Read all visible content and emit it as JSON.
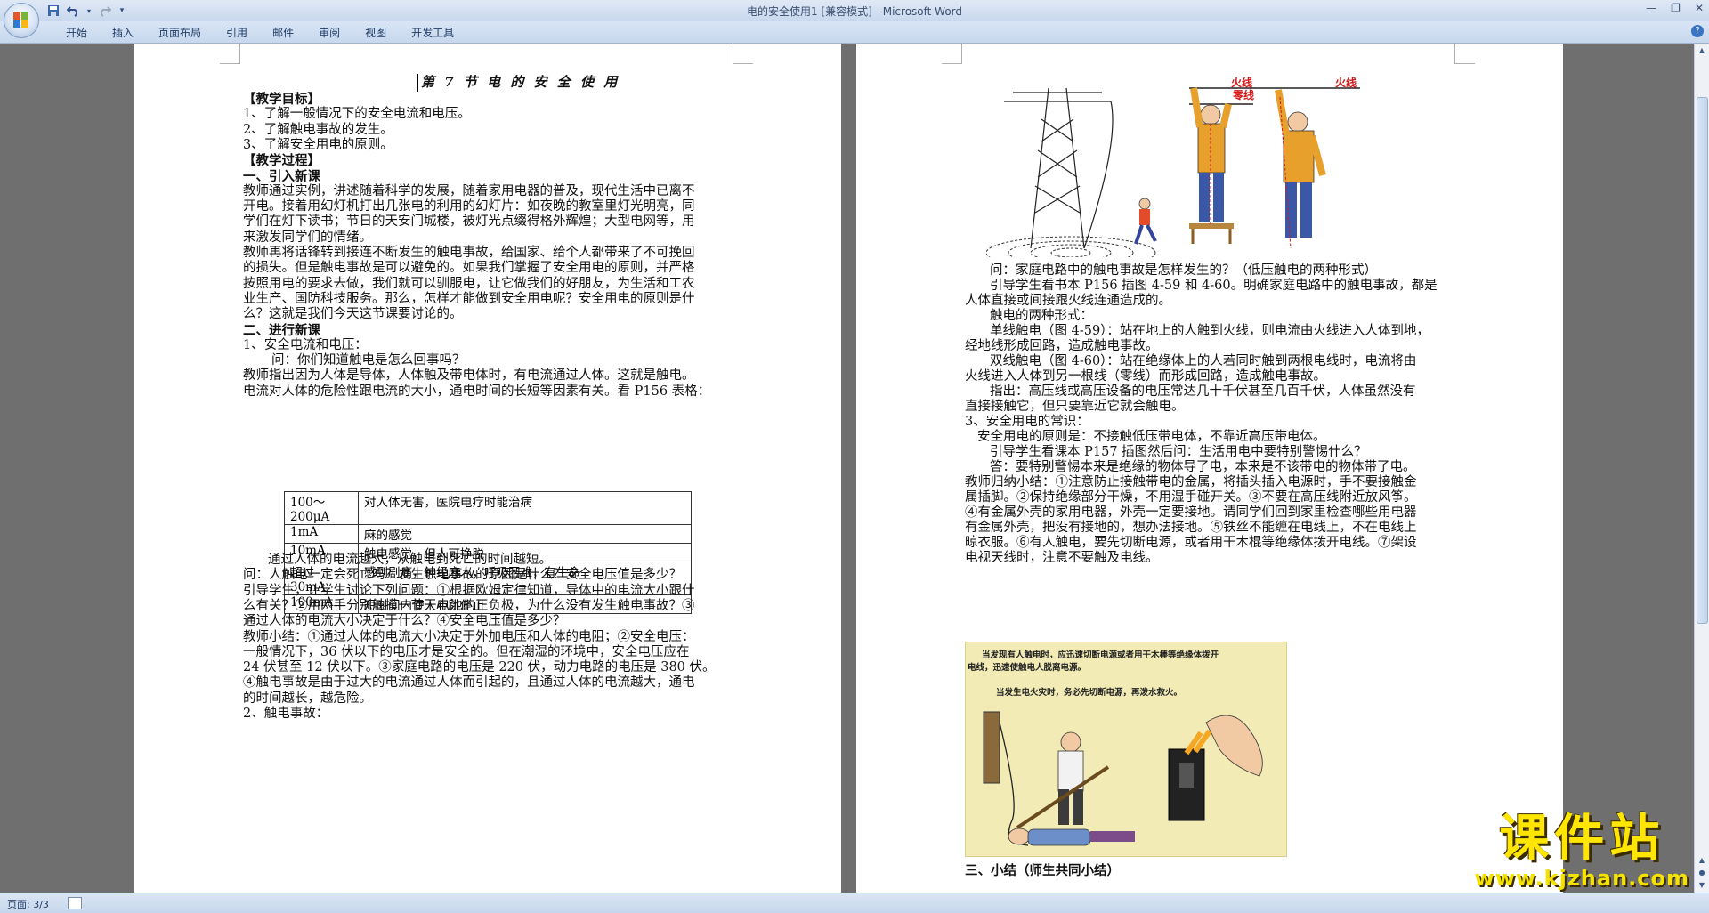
{
  "window": {
    "title": "电的安全使用1 [兼容模式] - Microsoft Word"
  },
  "quick_access": {
    "icons": [
      "save-icon",
      "undo-icon",
      "redo-icon",
      "customize-icon"
    ]
  },
  "ribbon": {
    "tabs": [
      "开始",
      "插入",
      "页面布局",
      "引用",
      "邮件",
      "审阅",
      "视图",
      "开发工具"
    ]
  },
  "status": {
    "page": "页面: 3/3"
  },
  "watermark": {
    "text": "课件站",
    "url": "www.kjzhan.com"
  },
  "left_page": {
    "title": "第 7 节   电 的 安 全 使 用",
    "lines": [
      "【教学目标】",
      "1、了解一般情况下的安全电流和电压。",
      "2、了解触电事故的发生。",
      "3、了解安全用电的原则。",
      "【教学过程】",
      "一、引入新课",
      "教师通过实例，讲述随着科学的发展，随着家用电器的普及，现代生活中已离不",
      "开电。接着用幻灯机打出几张电的利用的幻灯片：如夜晚的教室里灯光明亮，同",
      "学们在灯下读书；节日的天安门城楼，被灯光点缀得格外辉煌；大型电网等，用",
      "来激发同学们的情绪。",
      "教师再将话锋转到接连不断发生的触电事故，给国家、给个人都带来了不可挽回",
      "的损失。但是触电事故是可以避免的。如果我们掌握了安全用电的原则，并严格",
      "按照用电的要求去做，我们就可以驯服电，让它做我们的好朋友，为生活和工农",
      "业生产、国防科技服务。那么，怎样才能做到安全用电呢？安全用电的原则是什",
      "么？这就是我们今天这节课要讨论的。",
      "二、进行新课",
      "1、安全电流和电压：",
      "问：你们知道触电是怎么回事吗？",
      "教师指出因为人体是导体，人体触及带电体时，有电流通过人体。这就是触电。",
      "电流对人体的危险性跟电流的大小，通电时间的长短等因素有关。看 P156 表格："
    ],
    "table": [
      [
        "100～200μA",
        "对人体无害，医院电疗时能治病"
      ],
      [
        "1mA",
        "麻的感觉"
      ],
      [
        "10mA",
        "触电感觉，但人可挣脱"
      ],
      [
        "超过 30mA",
        "感到剧痛，神经麻木，呼吸困难，有生命"
      ],
      [
        "100mA",
        "短时间内使人心跳停止"
      ]
    ],
    "lines2": [
      "通过人体的电流越大，从触电到死亡的时间越短。",
      "问：人触电一定会死亡吗？发生触电事故的原因是什么？安全电压值是多少？",
      "引导学生，让学生讨论下列问题：①根据欧姆定律知道，导体中的电流大小跟什",
      "么有关？②用两手分别触摸一节干电池的正负极，为什么没有发生触电事故？③",
      "通过人体的电流大小决定于什么？④安全电压值是多少？",
      "教师小结：①通过人体的电流大小决定于外加电压和人体的电阻；②安全电压：",
      "一般情况下，36 伏以下的电压才是安全的。但在潮湿的环境中，安全电压应在",
      "24 伏甚至 12 伏以下。③家庭电路的电压是 220 伏，动力电路的电压是 380 伏。",
      "④触电事故是由于过大的电流通过人体而引起的，且通过人体的电流越大，通电",
      "的时间越长，越危险。",
      "2、触电事故："
    ]
  },
  "right_page": {
    "fig1_labels": [
      "火线",
      "零线",
      "火线"
    ],
    "lines": [
      "问：家庭电路中的触电事故是怎样发生的？（低压触电的两种形式）",
      "引导学生看书本 P156 插图 4-59 和 4-60。明确家庭电路中的触电事故，都是",
      "人体直接或间接跟火线连通造成的。",
      "触电的两种形式：",
      "单线触电（图 4-59）：站在地上的人触到火线，则电流由火线进入人体到地，",
      "经地线形成回路，造成触电事故。",
      "双线触电（图 4-60）：站在绝缘体上的人若同时触到两根电线时，电流将由",
      "火线进入人体到另一根线（零线）而形成回路，造成触电事故。",
      "指出：高压线或高压设备的电压常达几十千伏甚至几百千伏，人体虽然没有",
      "直接接触它，但只要靠近它就会触电。",
      "3、安全用电的常识：",
      "安全用电的原则是：不接触低压带电体，不靠近高压带电体。",
      "引导学生看课本 P157 插图然后问：生活用电中要特别警惕什么？",
      "答：要特别警惕本来是绝缘的物体导了电，本来是不该带电的物体带了电。",
      "教师归纳小结：①注意防止接触带电的金属，将插头插入电源时，手不要接触金",
      "属插脚。②保持绝缘部分干燥，不用湿手碰开关。③不要在高压线附近放风筝。",
      "④有金属外壳的家用电器，外壳一定要接地。请同学们回到家里检查哪些用电器",
      "有金属外壳，把没有接地的，想办法接地。⑤铁丝不能缠在电线上，不在电线上",
      "晾衣服。⑥有人触电，要先切断电源，或者用干木棍等绝缘体拨开电线。⑦架设",
      "电视天线时，注意不要触及电线。"
    ],
    "fig2_text1": "当发现有人触电时，应迅速切断电源或者用干木棒等绝缘体拨开",
    "fig2_text1b": "电线，迅速使触电人脱离电源。",
    "fig2_text2": "当发生电火灾时，务必先切断电源，再泼水救火。",
    "summary": "三、小结（师生共同小结）"
  }
}
